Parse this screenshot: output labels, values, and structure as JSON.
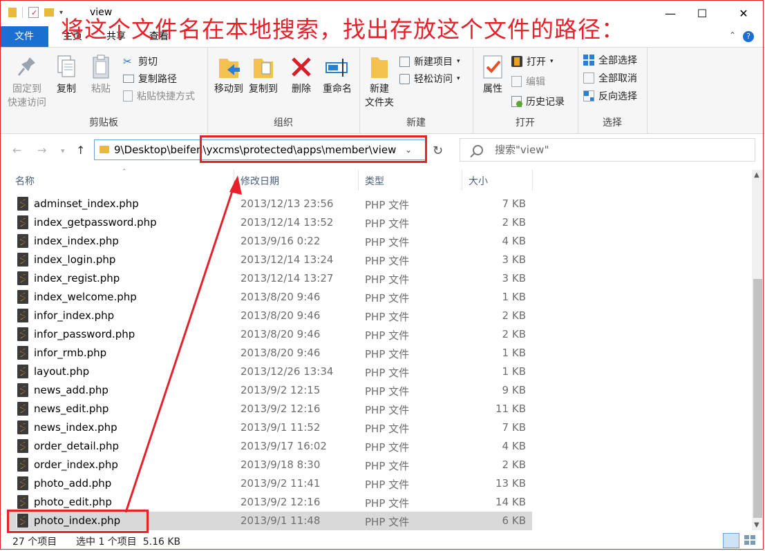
{
  "titlebar": {
    "title": "view",
    "annotation": "将这个文件名在本地搜索，找出存放这个文件的路径：",
    "minimize": "—",
    "maximize": "☐",
    "close": "✕"
  },
  "tabs": {
    "file": "文件",
    "home": "主页",
    "share": "共享",
    "view": "查看",
    "help": "?"
  },
  "ribbon": {
    "clipboard": {
      "label": "剪贴板",
      "pin": "固定到\n快速访问",
      "pin_l1": "固定到",
      "pin_l2": "快速访问",
      "copy": "复制",
      "paste": "粘贴",
      "cut": "剪切",
      "copy_path": "复制路径",
      "paste_shortcut": "粘贴快捷方式"
    },
    "organize": {
      "label": "组织",
      "move_to": "移动到",
      "copy_to": "复制到",
      "delete": "删除",
      "rename": "重命名"
    },
    "new": {
      "label": "新建",
      "new_folder_l1": "新建",
      "new_folder_l2": "文件夹",
      "new_item": "新建项目",
      "easy_access": "轻松访问"
    },
    "open": {
      "label": "打开",
      "properties": "属性",
      "open": "打开",
      "edit": "编辑",
      "history": "历史记录"
    },
    "select": {
      "label": "选择",
      "select_all": "全部选择",
      "select_none": "全部取消",
      "invert": "反向选择"
    }
  },
  "address": {
    "path": "9\\Desktop\\beifen\\yxcms\\protected\\apps\\member\\view",
    "search_placeholder": "搜索\"view\""
  },
  "columns": {
    "name": "名称",
    "date": "修改日期",
    "type": "类型",
    "size": "大小"
  },
  "files": [
    {
      "name": "adminset_index.php",
      "date": "2013/12/13 23:56",
      "type": "PHP 文件",
      "size": "7 KB"
    },
    {
      "name": "index_getpassword.php",
      "date": "2013/12/14 13:52",
      "type": "PHP 文件",
      "size": "2 KB"
    },
    {
      "name": "index_index.php",
      "date": "2013/9/16 0:22",
      "type": "PHP 文件",
      "size": "4 KB"
    },
    {
      "name": "index_login.php",
      "date": "2013/12/14 13:24",
      "type": "PHP 文件",
      "size": "3 KB"
    },
    {
      "name": "index_regist.php",
      "date": "2013/12/14 13:27",
      "type": "PHP 文件",
      "size": "3 KB"
    },
    {
      "name": "index_welcome.php",
      "date": "2013/8/20 9:46",
      "type": "PHP 文件",
      "size": "1 KB"
    },
    {
      "name": "infor_index.php",
      "date": "2013/8/20 9:46",
      "type": "PHP 文件",
      "size": "2 KB"
    },
    {
      "name": "infor_password.php",
      "date": "2013/8/20 9:46",
      "type": "PHP 文件",
      "size": "2 KB"
    },
    {
      "name": "infor_rmb.php",
      "date": "2013/8/20 9:46",
      "type": "PHP 文件",
      "size": "1 KB"
    },
    {
      "name": "layout.php",
      "date": "2013/12/26 13:34",
      "type": "PHP 文件",
      "size": "1 KB"
    },
    {
      "name": "news_add.php",
      "date": "2013/9/2 12:15",
      "type": "PHP 文件",
      "size": "9 KB"
    },
    {
      "name": "news_edit.php",
      "date": "2013/9/2 12:16",
      "type": "PHP 文件",
      "size": "11 KB"
    },
    {
      "name": "news_index.php",
      "date": "2013/9/1 11:52",
      "type": "PHP 文件",
      "size": "7 KB"
    },
    {
      "name": "order_detail.php",
      "date": "2013/9/17 16:02",
      "type": "PHP 文件",
      "size": "4 KB"
    },
    {
      "name": "order_index.php",
      "date": "2013/9/18 8:30",
      "type": "PHP 文件",
      "size": "2 KB"
    },
    {
      "name": "photo_add.php",
      "date": "2013/9/2 11:41",
      "type": "PHP 文件",
      "size": "13 KB"
    },
    {
      "name": "photo_edit.php",
      "date": "2013/9/2 12:16",
      "type": "PHP 文件",
      "size": "14 KB"
    },
    {
      "name": "photo_index.php",
      "date": "2013/9/1 11:48",
      "type": "PHP 文件",
      "size": "6 KB",
      "selected": true
    }
  ],
  "status": {
    "count": "27 个项目",
    "selection": "选中 1 个项目  5.16 KB"
  },
  "colors": {
    "accent": "#1a6fd0",
    "annotation": "#e8202a",
    "selected_row": "#d9d9d9"
  }
}
